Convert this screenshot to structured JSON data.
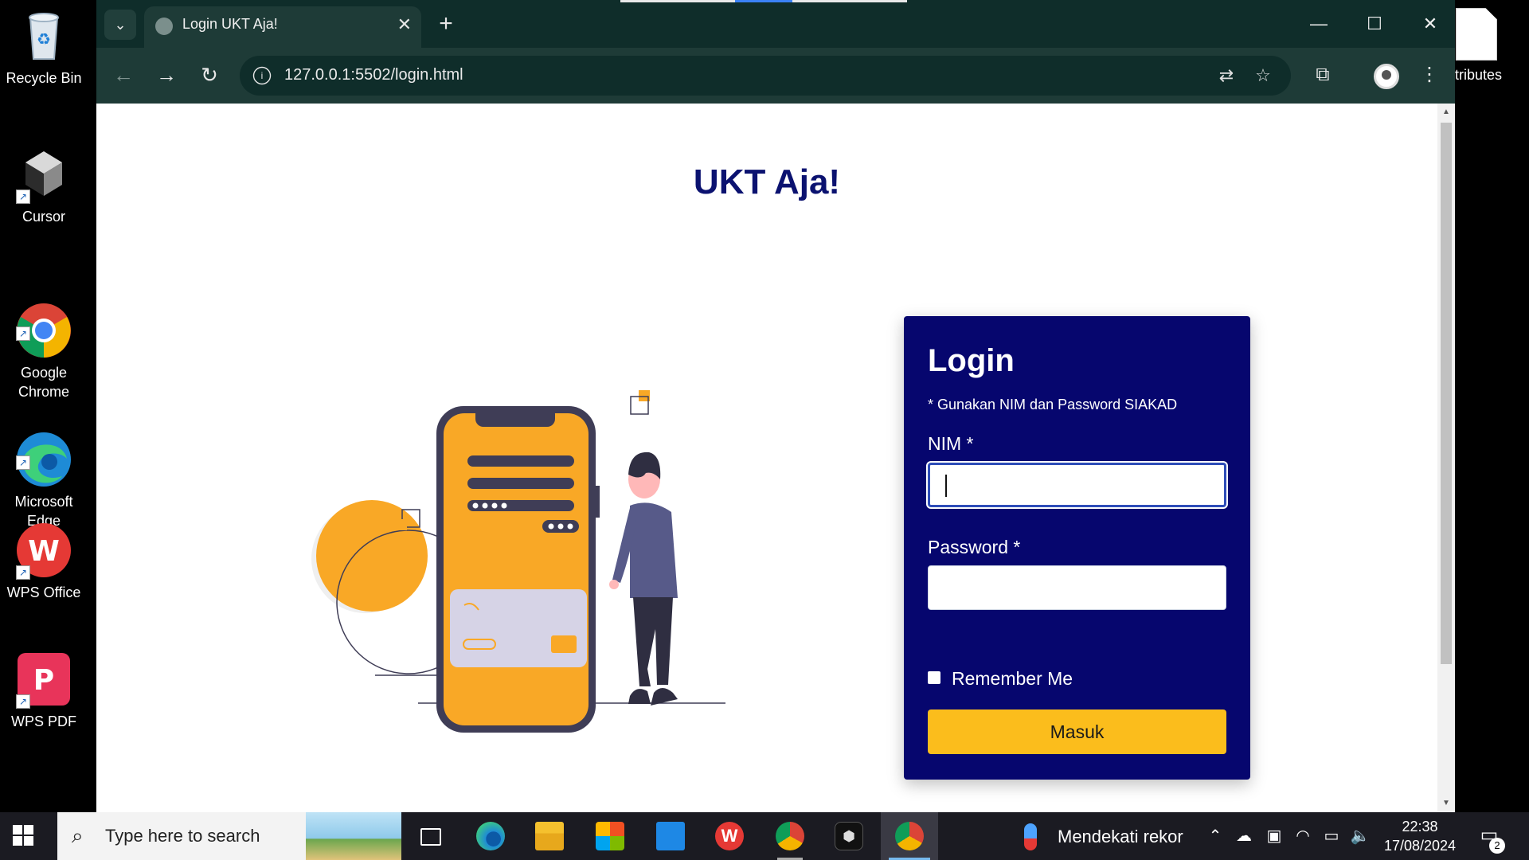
{
  "desktop": {
    "icons": [
      {
        "label": "Recycle Bin"
      },
      {
        "label": "Cursor"
      },
      {
        "label": "Google\nChrome"
      },
      {
        "label": "Microsoft\nEdge"
      },
      {
        "label": "WPS Office"
      },
      {
        "label": "WPS PDF"
      }
    ],
    "right_file_label": "ttributes"
  },
  "browser": {
    "tab": {
      "title": "Login UKT Aja!",
      "close": "✕"
    },
    "new_tab": "+",
    "tab_dropdown": "⌄",
    "window_controls": {
      "minimize": "—",
      "maximize": "☐",
      "close": "✕"
    },
    "url": "127.0.0.1:5502/login.html",
    "icons": {
      "back": "←",
      "forward": "→",
      "reload": "↻",
      "site_info": "i",
      "translate": "⇄",
      "star": "☆",
      "extensions": "⧉",
      "menu": "⋮"
    }
  },
  "page": {
    "title": "UKT Aja!",
    "login": {
      "heading": "Login",
      "note": "* Gunakan NIM dan Password SIAKAD",
      "nim_label": "NIM *",
      "nim_value": "",
      "password_label": "Password *",
      "password_value": "",
      "remember_label": "Remember Me",
      "remember_checked": false,
      "submit_label": "Masuk"
    },
    "colors": {
      "title": "#0b1270",
      "card": "#06066e",
      "button": "#fbbd1c",
      "illustration_accent": "#f9a826",
      "illustration_dark": "#3f3d56"
    }
  },
  "taskbar": {
    "search_placeholder": "Type here to search",
    "weather_text": "Mendekati rekor",
    "time": "22:38",
    "date": "17/08/2024",
    "notification_count": "2",
    "apps": [
      "task-view",
      "edge",
      "file-explorer",
      "microsoft-store",
      "mail",
      "wps-office",
      "chrome-profile",
      "cursor",
      "chrome"
    ]
  }
}
